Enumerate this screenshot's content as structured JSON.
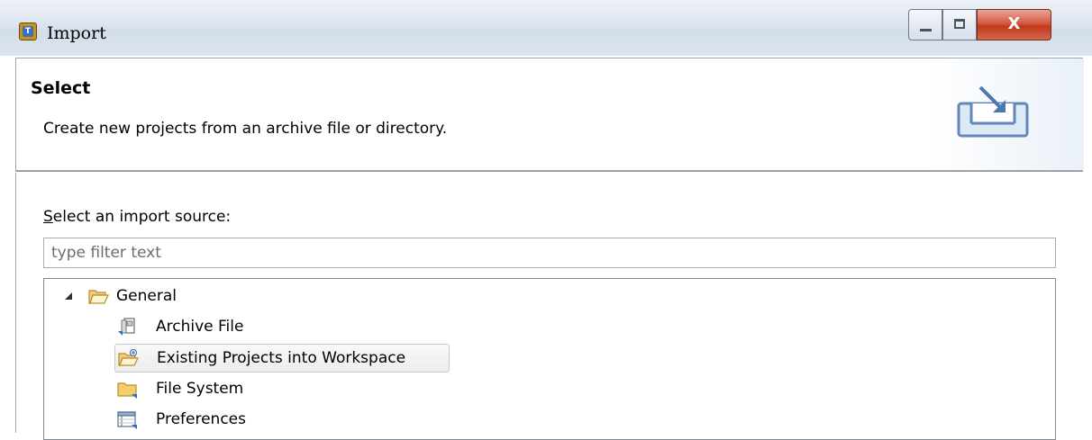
{
  "window": {
    "title": "Import",
    "close_symbol": "X",
    "app_icon_letter": "T"
  },
  "header": {
    "title": "Select",
    "description": "Create new projects from an archive file or directory.",
    "illustration_icon": "import-wizard-icon"
  },
  "source": {
    "label_prefix": "S",
    "label_rest": "elect an import source:",
    "filter_placeholder": "type filter text",
    "filter_value": ""
  },
  "tree": {
    "items": [
      {
        "label": "General",
        "icon": "open-folder-icon",
        "expanded": true,
        "selected": false
      },
      {
        "label": "Archive File",
        "icon": "archive-file-icon",
        "selected": false
      },
      {
        "label": "Existing Projects into Workspace",
        "icon": "project-folder-icon",
        "selected": true
      },
      {
        "label": "File System",
        "icon": "folder-icon",
        "selected": false
      },
      {
        "label": "Preferences",
        "icon": "preferences-icon",
        "selected": false
      }
    ]
  },
  "colors": {
    "title_bar": "#dce5ef",
    "close_button": "#c0391e",
    "selection": "#ececec"
  }
}
